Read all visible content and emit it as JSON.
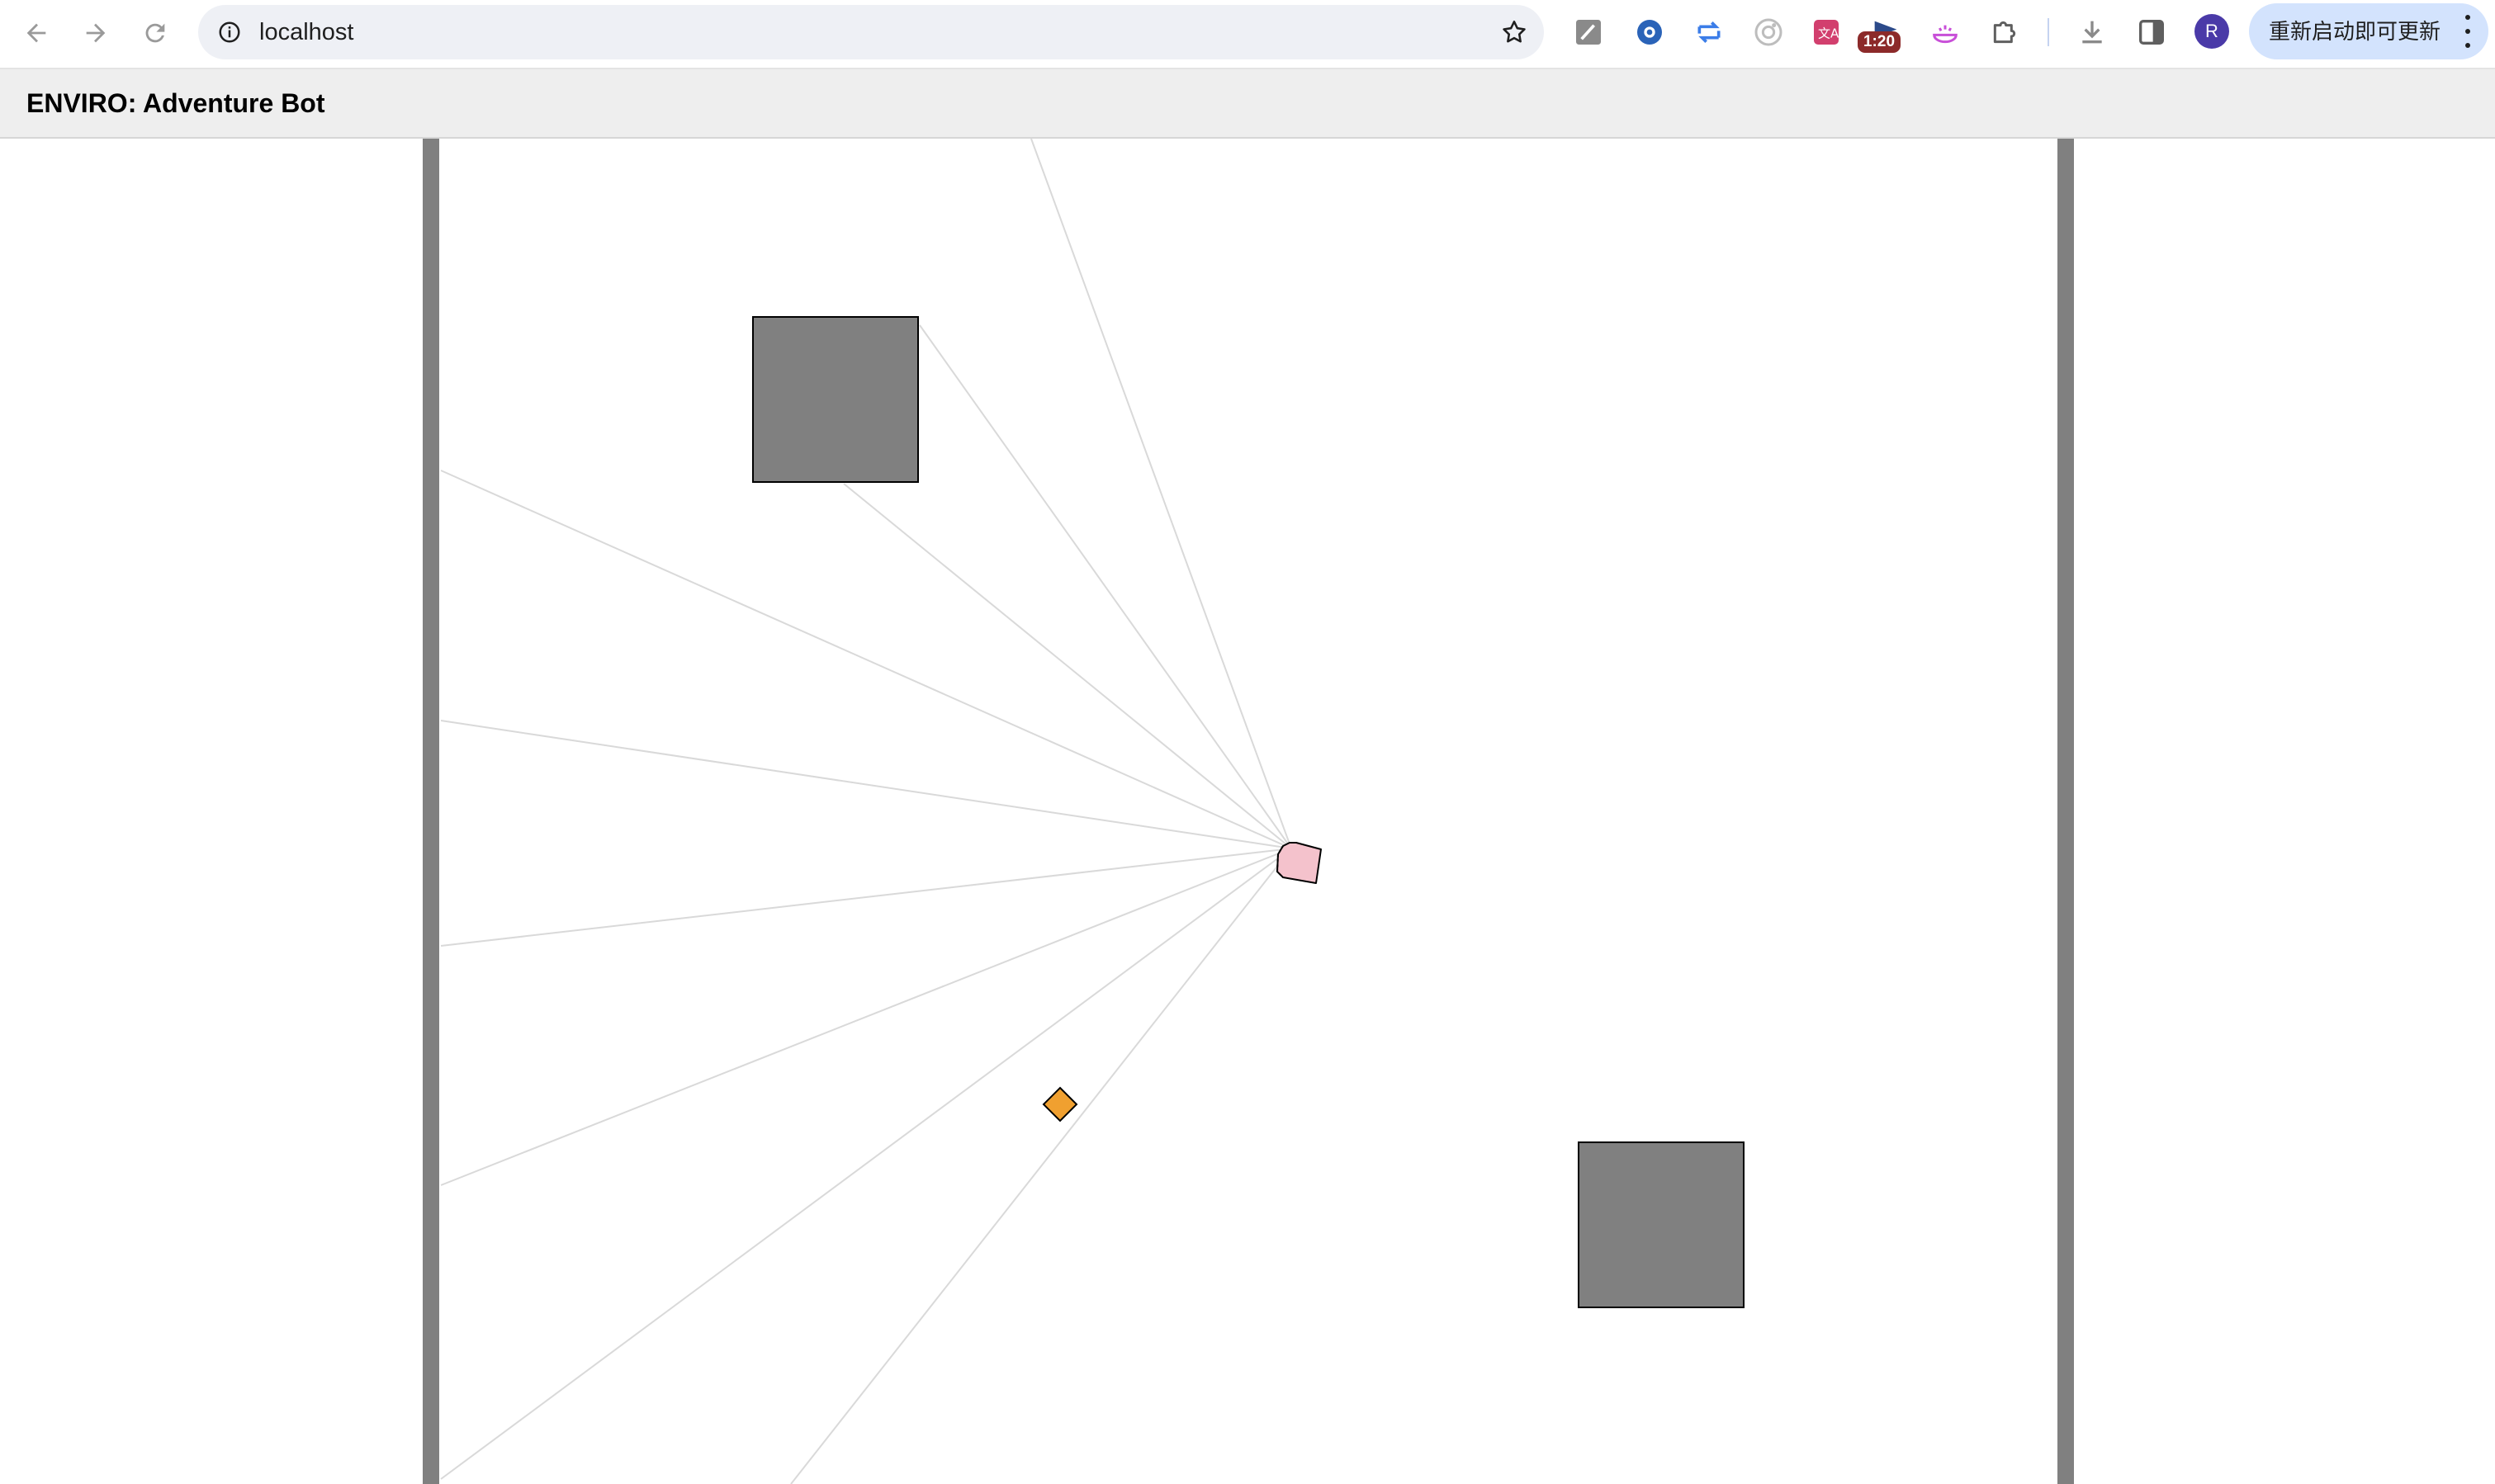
{
  "browser": {
    "url": "localhost",
    "badge_text": "1:20",
    "avatar_letter": "R",
    "update_button_label": "重新启动即可更新",
    "nav_icons": [
      "back-arrow-icon",
      "forward-arrow-icon",
      "reload-icon"
    ],
    "extension_icons": [
      "notes-extension-icon",
      "globe-extension-icon",
      "sync-extension-icon",
      "camera-extension-icon",
      "translate-extension-icon",
      "video-speed-extension-icon",
      "cloud-extension-icon",
      "puzzle-extension-icon"
    ],
    "toolbar_icons": [
      "download-icon",
      "side-panel-icon"
    ]
  },
  "app": {
    "title": "ENVIRO: Adventure Bot"
  },
  "colors": {
    "wall": "#808080",
    "obstacle": "#808080",
    "agent_fill": "#f4c2cc",
    "target_fill": "#f0a030",
    "sensor_ray": "#d9d9d9",
    "header_bg": "#eeeeee"
  }
}
